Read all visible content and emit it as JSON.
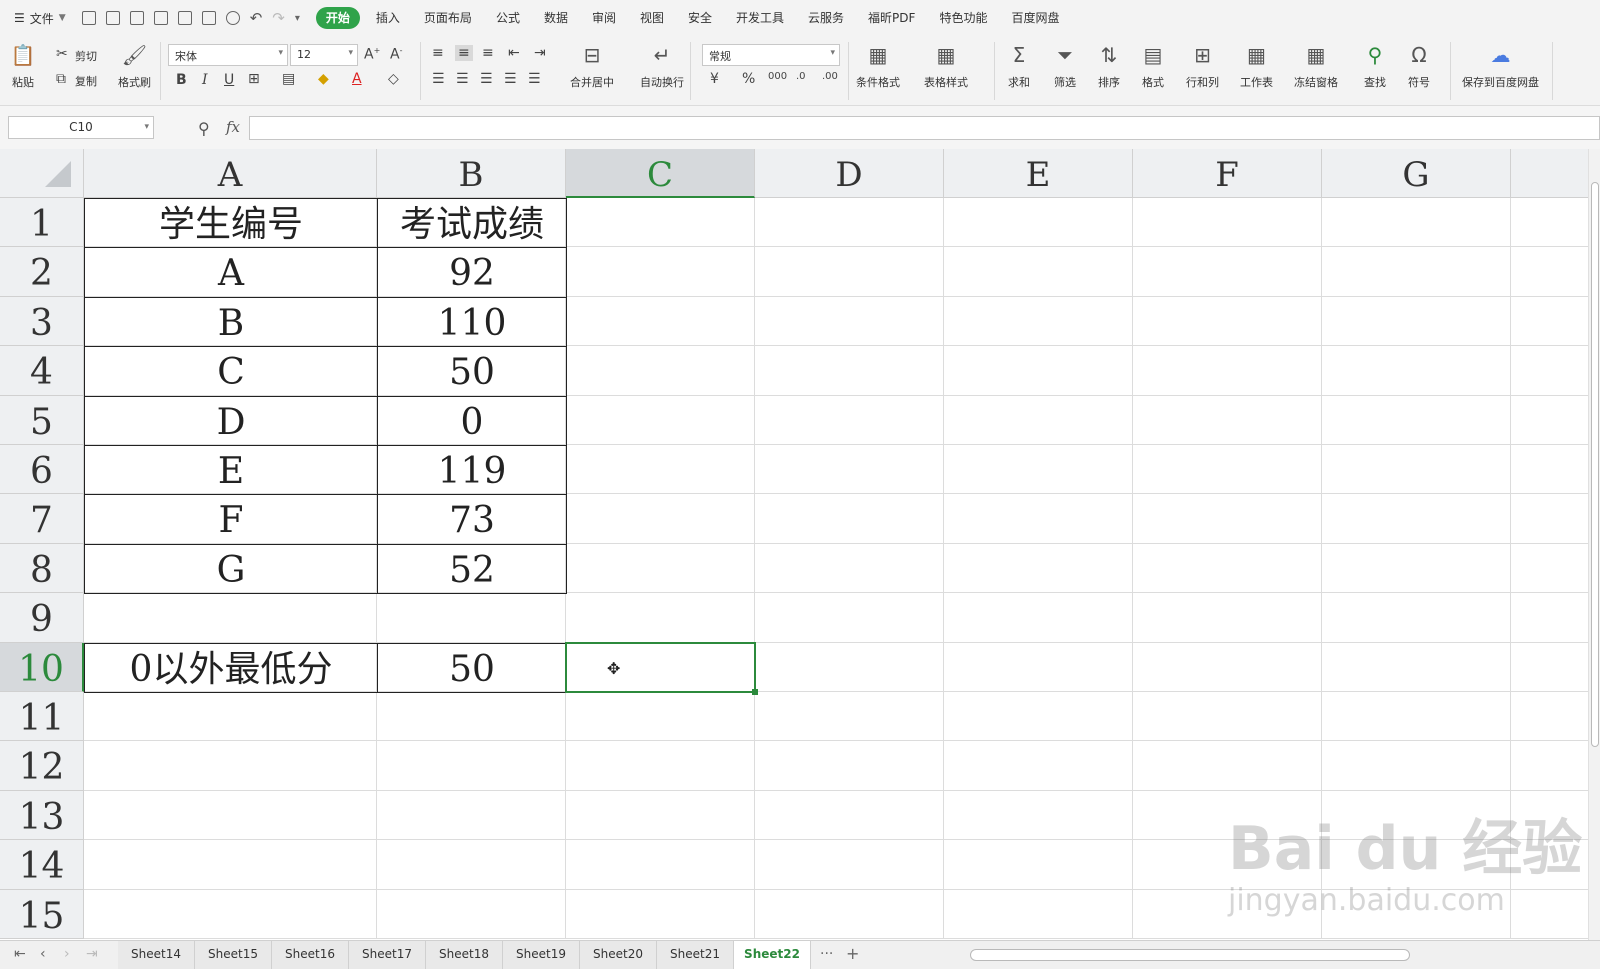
{
  "menubar": {
    "file_label": "文件",
    "tabs": [
      "开始",
      "插入",
      "页面布局",
      "公式",
      "数据",
      "审阅",
      "视图",
      "安全",
      "开发工具",
      "云服务",
      "福昕PDF",
      "特色功能",
      "百度网盘"
    ],
    "active_tab": "开始"
  },
  "ribbon": {
    "paste": "粘贴",
    "cut": "剪切",
    "copy": "复制",
    "format_painter": "格式刷",
    "font_name": "宋体",
    "font_size": "12",
    "merge_center": "合并居中",
    "wrap_text": "自动换行",
    "number_format": "常规",
    "conditional_format": "条件格式",
    "table_style": "表格样式",
    "sum": "求和",
    "filter": "筛选",
    "sort": "排序",
    "format": "格式",
    "rows_cols": "行和列",
    "worksheet": "工作表",
    "freeze": "冻结窗格",
    "find": "查找",
    "symbol": "符号",
    "save_baidu": "保存到百度网盘"
  },
  "formula_bar": {
    "name_box": "C10",
    "fx_label": "fx",
    "formula": ""
  },
  "columns": [
    "A",
    "B",
    "C",
    "D",
    "E",
    "F",
    "G"
  ],
  "rows": [
    "1",
    "2",
    "3",
    "4",
    "5",
    "6",
    "7",
    "8",
    "9",
    "10",
    "11",
    "12",
    "13",
    "14",
    "15"
  ],
  "selected_cell": "C10",
  "table": {
    "headers": [
      "学生编号",
      "考试成绩"
    ],
    "records": [
      {
        "id": "A",
        "score": "92"
      },
      {
        "id": "B",
        "score": "110"
      },
      {
        "id": "C",
        "score": "50"
      },
      {
        "id": "D",
        "score": "0"
      },
      {
        "id": "E",
        "score": "119"
      },
      {
        "id": "F",
        "score": "73"
      },
      {
        "id": "G",
        "score": "52"
      }
    ],
    "result_label": "0以外最低分",
    "result_value": "50"
  },
  "sheets": [
    "Sheet14",
    "Sheet15",
    "Sheet16",
    "Sheet17",
    "Sheet18",
    "Sheet19",
    "Sheet20",
    "Sheet21",
    "Sheet22"
  ],
  "active_sheet": "Sheet22",
  "watermark": {
    "brand": "Bai du 经验",
    "url": "jingyan.baidu.com"
  },
  "colors": {
    "accent": "#2c8a3c",
    "active_tab_bg": "#2fa34a"
  }
}
